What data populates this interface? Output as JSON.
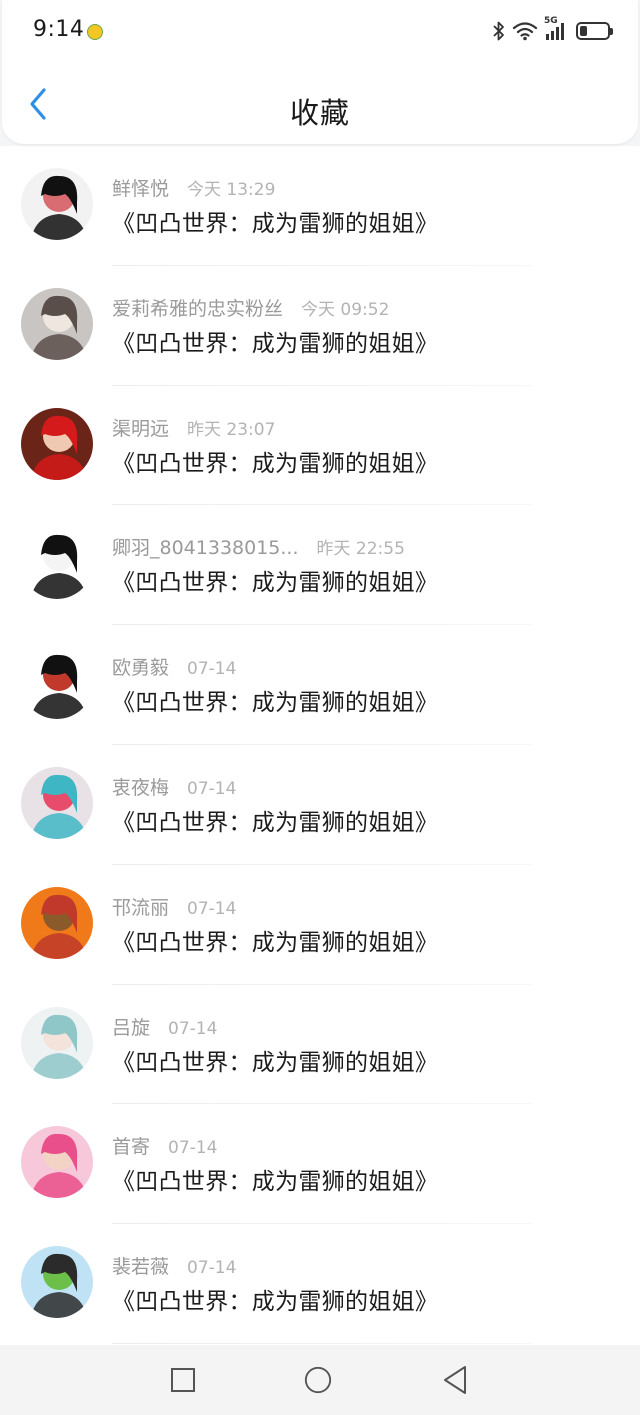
{
  "status_bar": {
    "time": "9:14",
    "network": "5G",
    "icons": [
      "bluetooth-icon",
      "wifi-icon",
      "cellular-signal-icon",
      "battery-icon"
    ],
    "battery_level": 0.25
  },
  "header": {
    "title": "收藏",
    "back_icon": "chevron-left-icon",
    "accent_color": "#2e8fe6"
  },
  "favorites": [
    {
      "name": "鲜怿悦",
      "time": "今天 13:29",
      "title": "《凹凸世界：成为雷狮的姐姐》",
      "avatar_colors": [
        "#f2f2f2",
        "#111111",
        "#d96c72"
      ]
    },
    {
      "name": "爱莉希雅的忠实粉丝",
      "time": "今天 09:52",
      "title": "《凹凸世界：成为雷狮的姐姐》",
      "avatar_colors": [
        "#c9c5c2",
        "#5a4e4a",
        "#efe6df"
      ]
    },
    {
      "name": "渠明远",
      "time": "昨天 23:07",
      "title": "《凹凸世界：成为雷狮的姐姐》",
      "avatar_colors": [
        "#6b2418",
        "#d41a1a",
        "#f0c9b2"
      ]
    },
    {
      "name": "卿羽_8041338015...",
      "time": "昨天 22:55",
      "title": "《凹凸世界：成为雷狮的姐姐》",
      "avatar_colors": [
        "#ffffff",
        "#111111",
        "#f4f4f4"
      ]
    },
    {
      "name": "欧勇毅",
      "time": "07-14",
      "title": "《凹凸世界：成为雷狮的姐姐》",
      "avatar_colors": [
        "#ffffff",
        "#111111",
        "#c0392b"
      ]
    },
    {
      "name": "衷夜梅",
      "time": "07-14",
      "title": "《凹凸世界：成为雷狮的姐姐》",
      "avatar_colors": [
        "#e8e1e6",
        "#3fb6c4",
        "#e74c6a"
      ]
    },
    {
      "name": "邗流丽",
      "time": "07-14",
      "title": "《凹凸世界：成为雷狮的姐姐》",
      "avatar_colors": [
        "#f07a1a",
        "#c0392b",
        "#8a5a2b"
      ]
    },
    {
      "name": "吕旋",
      "time": "07-14",
      "title": "《凹凸世界：成为雷狮的姐姐》",
      "avatar_colors": [
        "#eef2f2",
        "#8fc7c9",
        "#f3e3da"
      ]
    },
    {
      "name": "首寄",
      "time": "07-14",
      "title": "《凹凸世界：成为雷狮的姐姐》",
      "avatar_colors": [
        "#f7c8da",
        "#e94f8a",
        "#f2d4c4"
      ]
    },
    {
      "name": "裴若薇",
      "time": "07-14",
      "title": "《凹凸世界：成为雷狮的姐姐》",
      "avatar_colors": [
        "#bfe3f5",
        "#2b2b2b",
        "#6cc04a"
      ]
    }
  ],
  "nav_bar": {
    "buttons": [
      "recent-apps-icon",
      "home-icon",
      "back-icon"
    ]
  }
}
